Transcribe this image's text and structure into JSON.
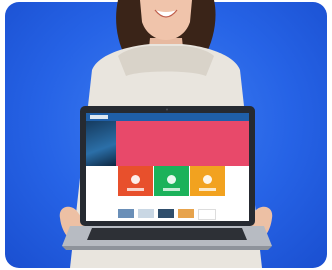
{
  "scene": {
    "background_color": "#2663e6",
    "subject": "smiling-woman-holding-laptop"
  },
  "website": {
    "header_color": "#1f5fa8",
    "hero_text": "",
    "hero_color": "#e8496a",
    "section_title": "",
    "cards": [
      {
        "label": "",
        "color": "#e8502c",
        "icon": "chart-icon"
      },
      {
        "label": "",
        "color": "#1bb25a",
        "icon": "gear-icon"
      },
      {
        "label": "",
        "color": "#f2a21f",
        "icon": "share-icon"
      }
    ]
  }
}
